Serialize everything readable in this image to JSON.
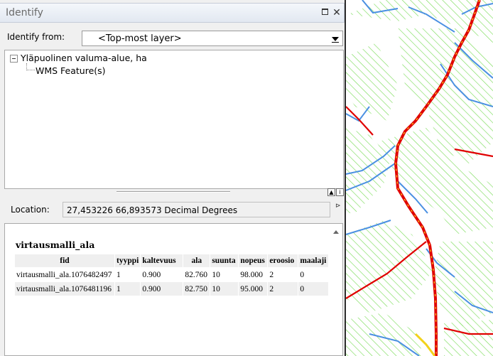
{
  "window": {
    "title": "Identify",
    "restore_label": "□",
    "close_label": "✕"
  },
  "identify_from": {
    "label": "Identify from:",
    "selected": "<Top-most layer>"
  },
  "tree": {
    "layer_name": "Yläpuolinen valuma-alue, ha",
    "feature_node": "WMS Feature(s)"
  },
  "location": {
    "label": "Location:",
    "value": "27,453226  66,893573 Decimal Degrees"
  },
  "results": {
    "feature_title": "virtausmalli_ala",
    "columns": [
      "fid",
      "tyyppi",
      "kaltevuus",
      "ala",
      "suunta",
      "nopeus",
      "eroosio",
      "maalaji"
    ],
    "rows": [
      [
        "virtausmalli_ala.1076482497",
        "1",
        "0.900",
        "82.760",
        "10",
        "98.000",
        "2",
        "0"
      ],
      [
        "virtausmalli_ala.1076481196",
        "1",
        "0.900",
        "82.750",
        "10",
        "95.000",
        "2",
        "0"
      ]
    ]
  },
  "map": {
    "colors": {
      "hatch_green": "#7ddc5c",
      "stream_blue": "#4a90e2",
      "river_red": "#e00000",
      "river_yellow": "#f2d21b",
      "background": "#ffffff"
    }
  }
}
